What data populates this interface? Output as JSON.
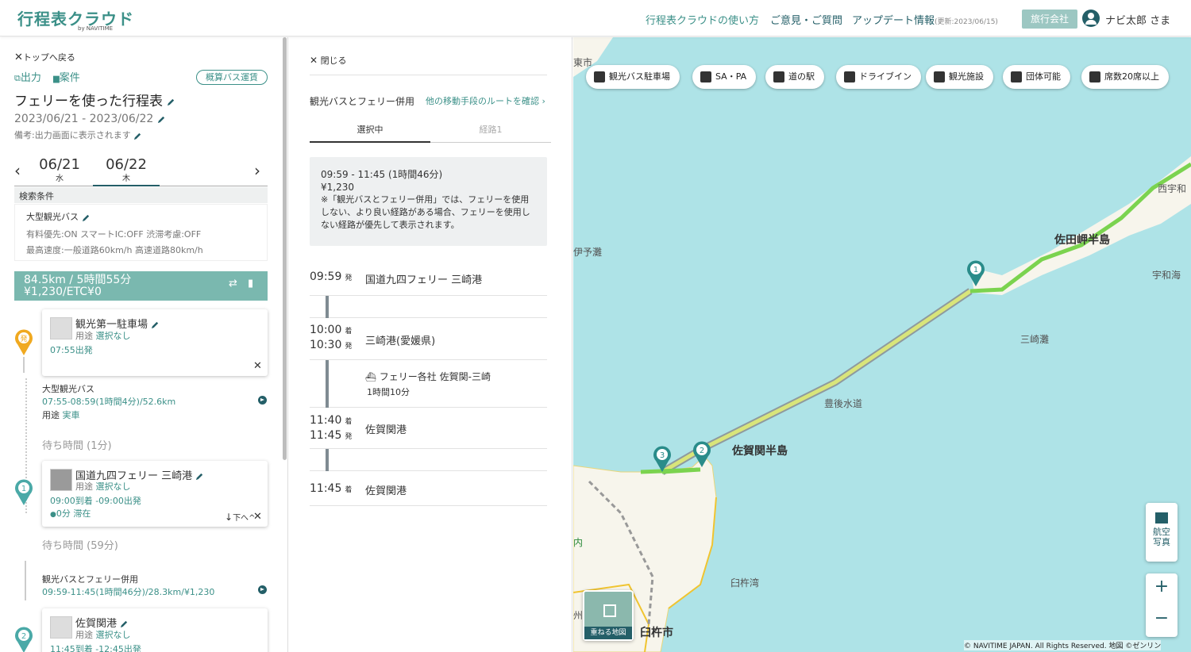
{
  "header": {
    "logo": "行程表クラウド",
    "logo_sub": "by NAVITIME",
    "nav": [
      "行程表クラウドの使い方",
      "ご意見・ご質問",
      "アップデート情報"
    ],
    "update_note": "(更新:2023/06/15)",
    "agency": "旅行会社",
    "user": "ナビ太郎 さま"
  },
  "left": {
    "back": "トップへ戻る",
    "output": "出力",
    "case": "案件",
    "fare_pill": "概算バス運賃",
    "title": "フェリーを使った行程表",
    "dates": "2023/06/21 - 2023/06/22",
    "note": "備考:出力画面に表示されます",
    "day1": {
      "date": "06/21",
      "dow": "水"
    },
    "day2": {
      "date": "06/22",
      "dow": "木"
    },
    "cond_header": "検索条件",
    "vehicle": "大型観光バス",
    "opts1": "有料優先:ON スマートIC:OFF 渋滞考慮:OFF",
    "opts2": "最高速度:一般道路60km/h 高速道路80km/h",
    "summary1": "84.5km / 5時間55分",
    "summary2": "¥1,230/ETC¥0",
    "stops": [
      {
        "name": "観光第一駐車場",
        "use_label": "用途",
        "use": "選択なし",
        "time": "07:55出発",
        "pin": "発"
      },
      {
        "name": "国道九四フェリー 三崎港",
        "use_label": "用途",
        "use": "選択なし",
        "time": "09:00到着 -09:00出発",
        "stay": "0分 滞在",
        "pin": "1",
        "move": "下へ"
      },
      {
        "name": "佐賀関港",
        "use_label": "用途",
        "use": "選択なし",
        "time": "11:45到着 -12:45出発",
        "pin": "2"
      }
    ],
    "legs": [
      {
        "name": "大型観光バス",
        "detail": "07:55-08:59(1時間4分)/52.6km",
        "use_label": "用途",
        "use": "実車"
      },
      {
        "name": "観光バスとフェリー併用",
        "detail": "09:59-11:45(1時間46分)/28.3km/¥1,230"
      }
    ],
    "waits": [
      "待ち時間 (1分)",
      "待ち時間 (59分)"
    ]
  },
  "middle": {
    "close": "閉じる",
    "route_title": "観光バスとフェリー併用",
    "other_link": "他の移動手段のルートを確認",
    "tab_selected": "選択中",
    "tab_route1": "経路1",
    "info_time": "09:59 - 11:45 (1時間46分)",
    "info_fare": "¥1,230",
    "info_note": "※「観光バスとフェリー併用」では、フェリーを使用しない、より良い経路がある場合、フェリーを使用しない経路が優先して表示されます。",
    "steps": [
      {
        "times": [
          {
            "t": "09:59",
            "k": "発"
          }
        ],
        "name": "国道九四フェリー 三崎港"
      },
      {
        "times": [
          {
            "t": "10:00",
            "k": "着"
          },
          {
            "t": "10:30",
            "k": "発"
          }
        ],
        "name": "三崎港(愛媛県)"
      },
      {
        "times": [
          {
            "t": "11:40",
            "k": "着"
          },
          {
            "t": "11:45",
            "k": "発"
          }
        ],
        "name": "佐賀関港"
      },
      {
        "times": [
          {
            "t": "11:45",
            "k": "着"
          }
        ],
        "name": "佐賀関港"
      }
    ],
    "ferry_name": "フェリー各社 佐賀関-三崎",
    "ferry_dur": "1時間10分"
  },
  "map": {
    "chips": [
      "観光バス駐車場",
      "SA・PA",
      "道の駅",
      "ドライブイン",
      "観光施設",
      "団体可能",
      "席数20席以上"
    ],
    "labels": [
      "東市",
      "伊予灘",
      "西宇和",
      "佐田岬半島",
      "宇和海",
      "三崎灘",
      "豊後水道",
      "佐賀関半島",
      "臼杵湾",
      "臼杵市",
      "内",
      "州"
    ],
    "aerial": "航空写真",
    "overlay": "重ねる地図",
    "copyright": "© NAVITIME JAPAN. All Rights Reserved. 地図 ©ゼンリン",
    "markers": [
      "1",
      "2",
      "3"
    ],
    "colors": {
      "sea": "#aee3e7",
      "land": "#f7f5ec",
      "route": "#d9e57a",
      "route_green": "#7bd34f"
    }
  }
}
